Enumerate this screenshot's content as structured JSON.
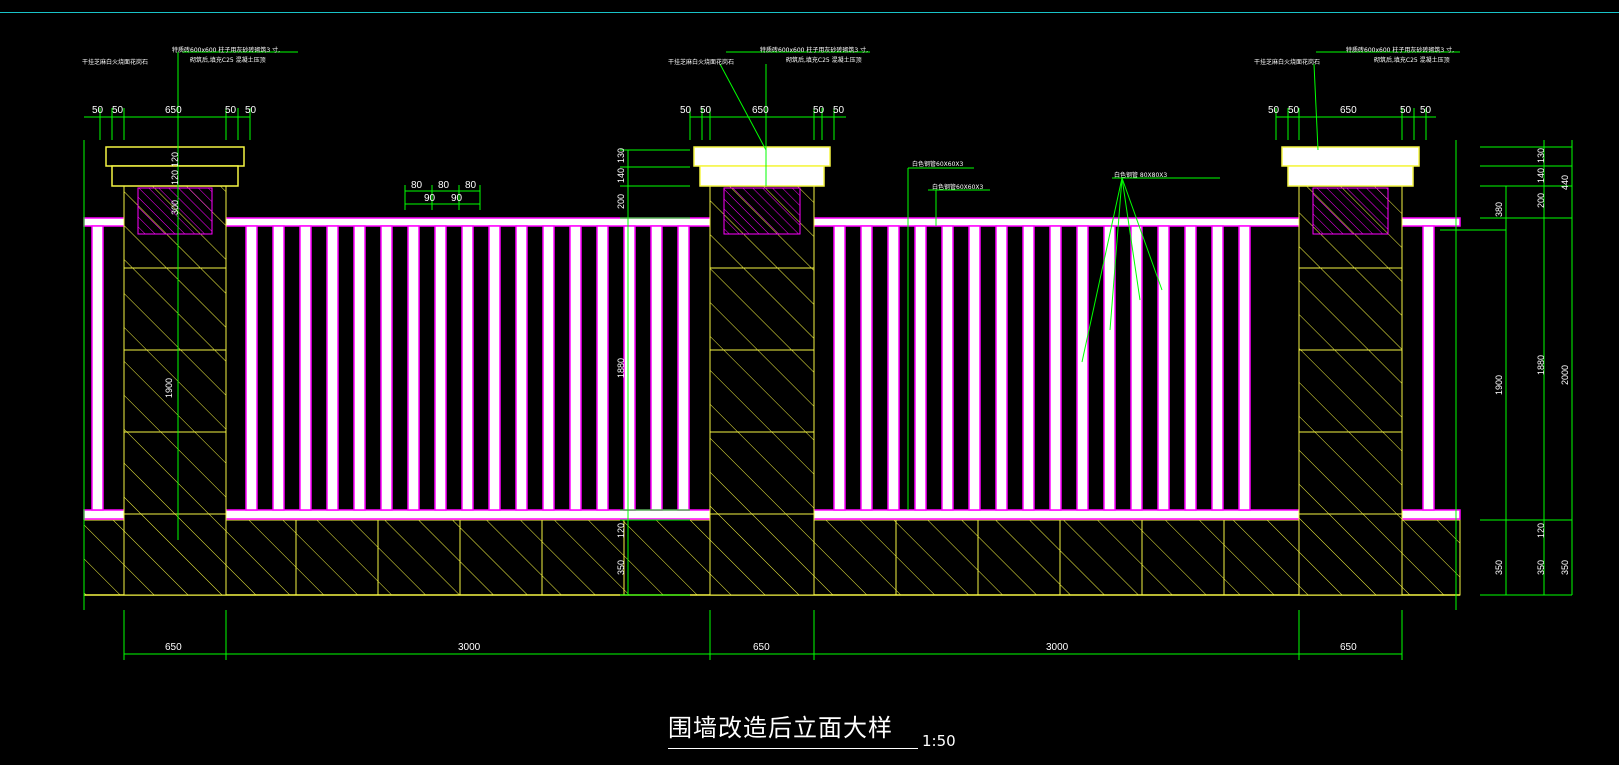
{
  "drawing": {
    "title": "围墙改造后立面大样",
    "scale": "1:50",
    "colors": {
      "background": "#000000",
      "line": "#f5f542",
      "rail": "#ff00ff",
      "dimension": "#00ff00",
      "border": "#19c3c8"
    },
    "pillar_notes": {
      "left_a": "干挂芝麻白火烧面花岗石",
      "left_b": "特质砖600x600  柱子用灰砂砖砌筑3 寸,",
      "left_c": "砌筑后,填充C25  混凝土压顶",
      "mid_a": "干挂芝麻白火烧面花岗石",
      "mid_b": "特质砖600x600  柱子用灰砂砖砌筑3 寸,",
      "mid_c": "砌筑后,填充C25  混凝土压顶",
      "right_a": "干挂芝麻白火烧面花岗石",
      "right_b": "特质砖600x600  柱子用灰砂砖砌筑3 寸,",
      "right_c": "砌筑后,填充C25  混凝土压顶"
    },
    "rail_notes": {
      "top_rail": "白色钢管60X60X3",
      "top_rail_2": "白色钢管60X60X3",
      "bars": "白色钢管 80X80X3"
    },
    "dims_top": {
      "l1": "50",
      "l2": "50",
      "l3": "650",
      "l4": "50",
      "l5": "50",
      "m1": "50",
      "m2": "50",
      "m3": "650",
      "m4": "50",
      "m5": "50",
      "r1": "50",
      "r2": "50",
      "r3": "650",
      "r4": "50",
      "r5": "50"
    },
    "dims_bars": {
      "a": "80",
      "b": "80",
      "c": "80",
      "d": "90",
      "e": "90"
    },
    "dims_bottom": {
      "p1": "650",
      "s1": "3000",
      "p2": "650",
      "s2": "3000",
      "p3": "650"
    },
    "dims_left_pillar": {
      "cap": "120",
      "cap2": "120",
      "panel": "300",
      "height": "1900"
    },
    "dims_mid": {
      "a": "130",
      "b": "140",
      "c": "200",
      "height": "1880",
      "base": "120",
      "plinth": "350"
    },
    "dims_right": {
      "a": "130",
      "b": "140",
      "c": "200",
      "d": "380",
      "e": "440",
      "h1": "1900",
      "h2": "1880",
      "h3": "2000",
      "base1": "120",
      "p1": "350",
      "p2": "350",
      "p3": "350"
    }
  }
}
